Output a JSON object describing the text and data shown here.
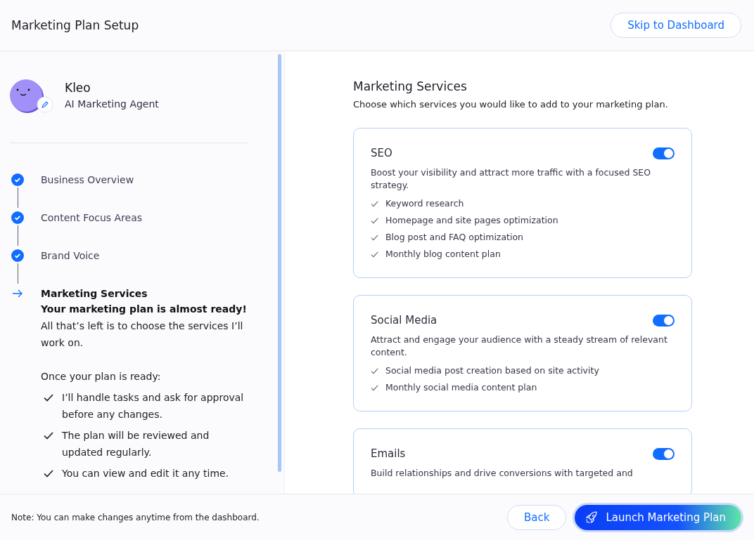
{
  "header": {
    "title": "Marketing Plan Setup",
    "skip_button": "Skip to Dashboard"
  },
  "agent": {
    "name": "Kleo",
    "role": "AI Marketing Agent"
  },
  "steps": [
    {
      "label": "Business Overview",
      "kind": "done"
    },
    {
      "label": "Content Focus Areas",
      "kind": "done"
    },
    {
      "label": "Brand Voice",
      "kind": "done"
    },
    {
      "label": "Marketing Services",
      "kind": "current"
    }
  ],
  "current_step": {
    "headline": "Your marketing plan is almost ready!",
    "text": "All that’s left is to choose the services I’ll work on.",
    "list_title": "Once your plan is ready:",
    "points": [
      "I’ll handle tasks and ask for approval before any changes.",
      "The plan will be reviewed and updated regularly.",
      "You can view and edit it any time."
    ]
  },
  "main": {
    "title": "Marketing Services",
    "subtitle": "Choose which services you would like to add to your marketing plan.",
    "services": [
      {
        "name": "SEO",
        "on": true,
        "description": "Boost your visibility and attract more traffic with a focused SEO strategy.",
        "features": [
          "Keyword research",
          "Homepage and site pages optimization",
          "Blog post and FAQ optimization",
          "Monthly blog content plan"
        ]
      },
      {
        "name": "Social Media",
        "on": true,
        "description": "Attract and engage your audience with a steady stream of relevant content.",
        "features": [
          "Social media post creation based on site activity",
          "Monthly social media content plan"
        ]
      },
      {
        "name": "Emails",
        "on": true,
        "description": "Build relationships and drive conversions with targeted and"
      }
    ]
  },
  "footer": {
    "note": "Note: You can make changes anytime from the dashboard.",
    "back_button": "Back",
    "launch_button": "Launch Marketing Plan"
  }
}
